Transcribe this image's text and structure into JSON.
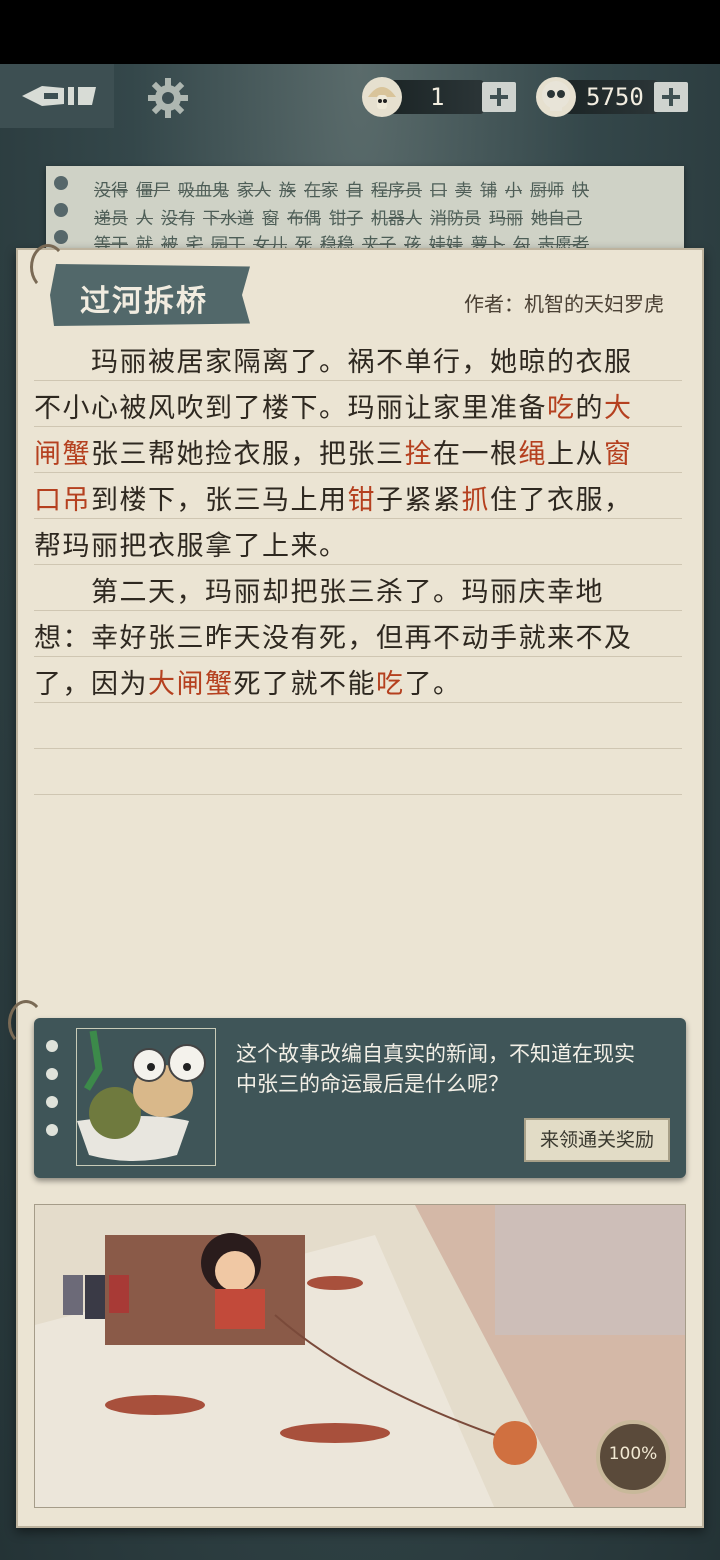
{
  "top_bar": {
    "resource1_value": "1",
    "resource2_value": "5750"
  },
  "word_sheet": {
    "rows": [
      [
        "没得",
        "僵尸",
        "吸血鬼",
        "家人",
        "族",
        "在家",
        "自",
        "程序员",
        "口",
        "卖",
        "铺",
        "小",
        "厨师",
        "快"
      ],
      [
        "递员",
        "人",
        "没有",
        "下水道",
        "窗",
        "布偶",
        "钳子",
        "机器人",
        "消防员",
        "玛丽",
        "她自己"
      ],
      [
        "等于",
        "就",
        "被",
        "宅",
        "园丁",
        "女儿",
        "死",
        "稳稳",
        "夹子",
        "孩",
        "娃娃",
        "萝卜",
        "勾",
        "志愿者"
      ]
    ]
  },
  "story": {
    "title": "过河拆桥",
    "author": "作者：机智的天妇罗虎",
    "lines": [
      [
        {
          "t": "　　玛丽被居家隔离了。祸不单行，她晾的衣服"
        }
      ],
      [
        {
          "t": "不小心被风吹到了楼下。玛丽让家里准备"
        },
        {
          "t": "吃",
          "h": true
        },
        {
          "t": "的"
        },
        {
          "t": "大",
          "h": true
        }
      ],
      [
        {
          "t": "闸蟹",
          "h": true
        },
        {
          "t": "张三帮她捡衣服，把张三"
        },
        {
          "t": "拴",
          "h": true
        },
        {
          "t": "在一根"
        },
        {
          "t": "绳",
          "h": true
        },
        {
          "t": "上从"
        },
        {
          "t": "窗",
          "h": true
        }
      ],
      [
        {
          "t": "口吊",
          "h": true
        },
        {
          "t": "到楼下，张三马上用"
        },
        {
          "t": "钳",
          "h": true
        },
        {
          "t": "子紧紧"
        },
        {
          "t": "抓",
          "h": true
        },
        {
          "t": "住了衣服，"
        }
      ],
      [
        {
          "t": "帮玛丽把衣服拿了上来。"
        }
      ],
      [
        {
          "t": "　　第二天，玛丽却把张三杀了。玛丽庆幸地"
        }
      ],
      [
        {
          "t": "想：幸好张三昨天没有死，但再不动手就来不及"
        }
      ],
      [
        {
          "t": "了，因为"
        },
        {
          "t": "大闸蟹",
          "h": true
        },
        {
          "t": "死了就不能"
        },
        {
          "t": "吃",
          "h": true
        },
        {
          "t": "了。"
        }
      ]
    ]
  },
  "tip": {
    "line1": "这个故事改编自真实的新闻，不知道在现实",
    "line2": "中张三的命运最后是什么呢？",
    "reward_button": "来领通关奖励"
  },
  "illustration": {
    "progress": "100%"
  },
  "colors": {
    "highlight": "#b5401f",
    "paper": "#ebe4d3",
    "board": "#34474a"
  }
}
